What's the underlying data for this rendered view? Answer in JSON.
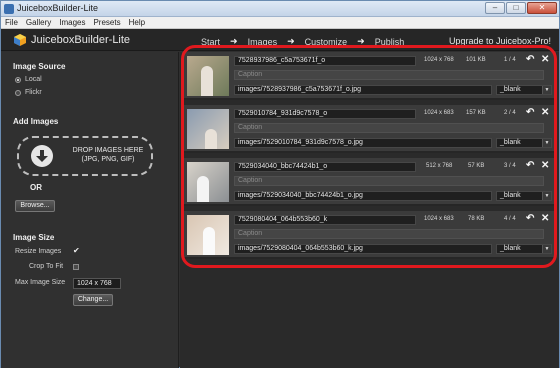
{
  "window": {
    "title": "JuiceboxBuilder-Lite",
    "controls": [
      "–",
      "□",
      "✕"
    ]
  },
  "menu": [
    "File",
    "Gallery",
    "Images",
    "Presets",
    "Help"
  ],
  "header": {
    "app_name": "JuiceboxBuilder-Lite",
    "steps": [
      "Start",
      "Images",
      "Customize",
      "Publish"
    ],
    "active_step": "Images",
    "upgrade_link": "Upgrade to Juicebox-Pro!"
  },
  "sidebar": {
    "image_source_title": "Image Source",
    "source_options": [
      "Local",
      "Flickr"
    ],
    "selected_source": "Local",
    "add_images_title": "Add Images",
    "drop_text": "DROP IMAGES HERE (JPG, PNG, GIF)",
    "or_label": "OR",
    "browse_label": "Browse...",
    "image_size_title": "Image Size",
    "resize_label": "Resize Images",
    "resize_checked": "✔",
    "crop_label": "Crop To Fit",
    "max_size_label": "Max Image Size",
    "max_size_value": "1024 x 768",
    "change_label": "Change..."
  },
  "images": [
    {
      "name": "7528937986_c5a753671f_o",
      "dims": "1024 x 768",
      "size": "101 KB",
      "index": "1 / 4",
      "caption_placeholder": "Caption",
      "path": "images/7528937986_c5a753671f_o.jpg",
      "target": "_blank"
    },
    {
      "name": "7529010784_931d9c7578_o",
      "dims": "1024 x 683",
      "size": "157 KB",
      "index": "2 / 4",
      "caption_placeholder": "Caption",
      "path": "images/7529010784_931d9c7578_o.jpg",
      "target": "_blank"
    },
    {
      "name": "7529034040_bbc74424b1_o",
      "dims": "512 x 768",
      "size": "57 KB",
      "index": "3 / 4",
      "caption_placeholder": "Caption",
      "path": "images/7529034040_bbc74424b1_o.jpg",
      "target": "_blank"
    },
    {
      "name": "7529080404_064b553b60_k",
      "dims": "1024 x 683",
      "size": "78 KB",
      "index": "4 / 4",
      "caption_placeholder": "Caption",
      "path": "images/7529080404_064b553b60_k.jpg",
      "target": "_blank"
    }
  ],
  "icons": {
    "undo": "undo-icon",
    "delete": "close-icon",
    "arrow": "➜"
  },
  "colors": {
    "highlight": "#e0191e",
    "background": "#2f2f2f",
    "panel": "#3b3b3b"
  }
}
